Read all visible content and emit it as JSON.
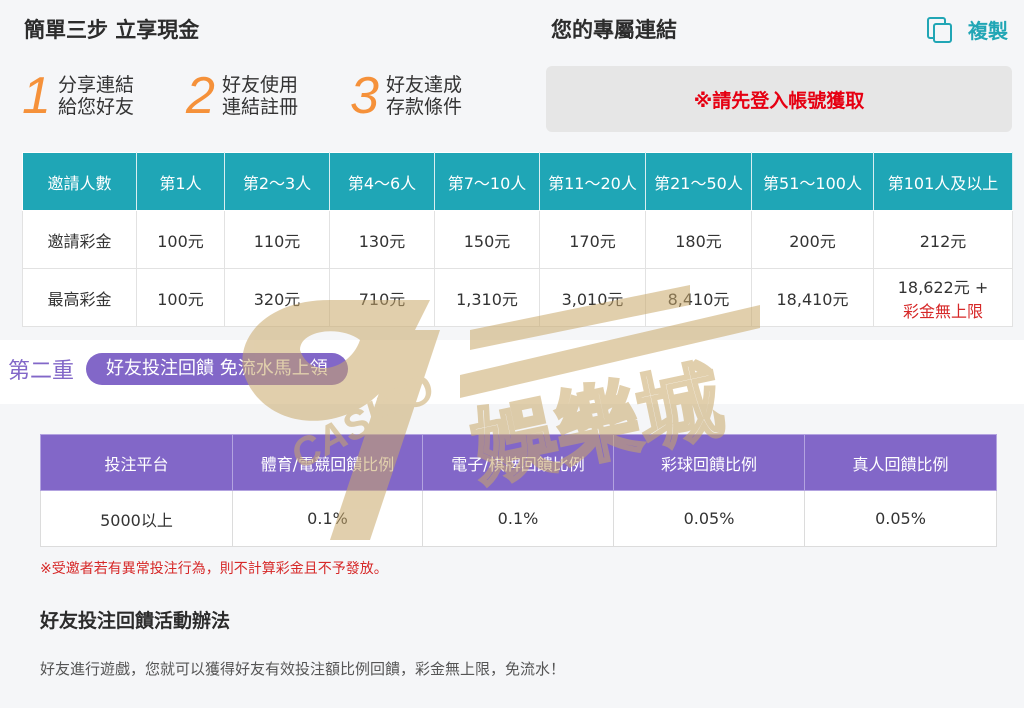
{
  "steps": {
    "title": "簡單三步 立享現金",
    "items": [
      {
        "num": "1",
        "line1": "分享連結",
        "line2": "給您好友"
      },
      {
        "num": "2",
        "line1": "好友使用",
        "line2": "連結註冊"
      },
      {
        "num": "3",
        "line1": "好友達成",
        "line2": "存款條件"
      }
    ]
  },
  "link": {
    "title": "您的專屬連結",
    "copy_label": "複製",
    "copy_icon": "copy-icon",
    "message": "※請先登入帳號獲取"
  },
  "invite_table": {
    "headers": [
      "邀請人數",
      "第1人",
      "第2～3人",
      "第4～6人",
      "第7～10人",
      "第11～20人",
      "第21～50人",
      "第51～100人",
      "第101人及以上"
    ],
    "rows": [
      {
        "label": "邀請彩金",
        "cells": [
          "100元",
          "110元",
          "130元",
          "150元",
          "170元",
          "180元",
          "200元",
          "212元"
        ]
      },
      {
        "label": "最高彩金",
        "cells": [
          "100元",
          "320元",
          "710元",
          "1,310元",
          "3,010元",
          "8,410元",
          "18,410元",
          "18,622元 +"
        ],
        "extra": "彩金無上限"
      }
    ]
  },
  "second": {
    "label": "第二重",
    "pill": "好友投注回饋 免流水馬上領"
  },
  "rebate_table": {
    "headers": [
      "投注平台",
      "體育/電競回饋比例",
      "電子/棋牌回饋比例",
      "彩球回饋比例",
      "真人回饋比例"
    ],
    "row": [
      "5000以上",
      "0.1%",
      "0.1%",
      "0.05%",
      "0.05%"
    ]
  },
  "note": "※受邀者若有異常投注行為，則不計算彩金且不予發放。",
  "method": {
    "title": "好友投注回饋活動辦法",
    "text": "好友進行遊戲，您就可以獲得好友有效投注額比例回饋，彩金無上限，免流水！"
  },
  "watermark": {
    "brand": "CASINO",
    "cn": "娛樂城"
  },
  "colors": {
    "teal": "#1fa6b6",
    "purple": "#8267c8",
    "orange": "#f5913a",
    "red": "#e60012"
  }
}
